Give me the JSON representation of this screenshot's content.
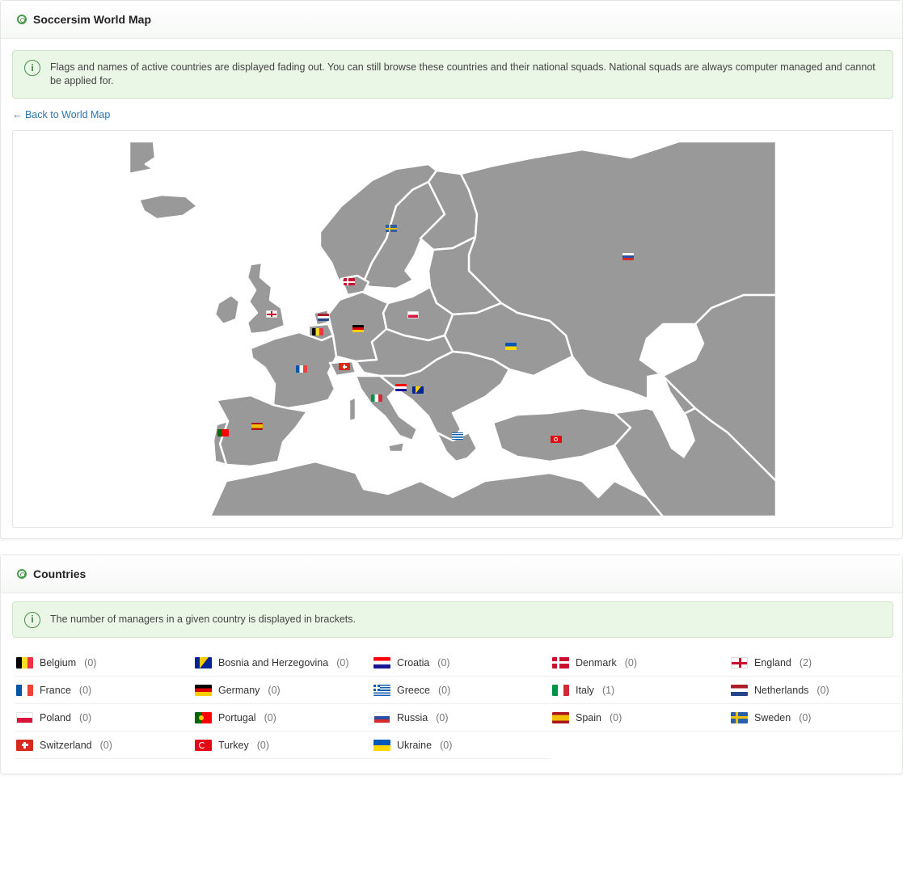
{
  "map_panel": {
    "title": "Soccersim World Map",
    "info_text": "Flags and names of active countries are displayed fading out. You can still browse these countries and their national squads. National squads are always computer managed and cannot be applied for.",
    "back_link": "← Back to World Map"
  },
  "countries_panel": {
    "title": "Countries",
    "info_text": "The number of managers in a given country is displayed in brackets.",
    "countries": [
      {
        "name": "Belgium",
        "count": "(0)",
        "flag": "belgium-flag-icon"
      },
      {
        "name": "Bosnia and Herzegovina",
        "count": "(0)",
        "flag": "bosnia-flag-icon"
      },
      {
        "name": "Croatia",
        "count": "(0)",
        "flag": "croatia-flag-icon"
      },
      {
        "name": "Denmark",
        "count": "(0)",
        "flag": "denmark-flag-icon"
      },
      {
        "name": "England",
        "count": "(2)",
        "flag": "england-flag-icon"
      },
      {
        "name": "France",
        "count": "(0)",
        "flag": "france-flag-icon"
      },
      {
        "name": "Germany",
        "count": "(0)",
        "flag": "germany-flag-icon"
      },
      {
        "name": "Greece",
        "count": "(0)",
        "flag": "greece-flag-icon"
      },
      {
        "name": "Italy",
        "count": "(1)",
        "flag": "italy-flag-icon"
      },
      {
        "name": "Netherlands",
        "count": "(0)",
        "flag": "netherlands-flag-icon"
      },
      {
        "name": "Poland",
        "count": "(0)",
        "flag": "poland-flag-icon"
      },
      {
        "name": "Portugal",
        "count": "(0)",
        "flag": "portugal-flag-icon"
      },
      {
        "name": "Russia",
        "count": "(0)",
        "flag": "russia-flag-icon"
      },
      {
        "name": "Spain",
        "count": "(0)",
        "flag": "spain-flag-icon"
      },
      {
        "name": "Sweden",
        "count": "(0)",
        "flag": "sweden-flag-icon"
      },
      {
        "name": "Switzerland",
        "count": "(0)",
        "flag": "switzerland-flag-icon"
      },
      {
        "name": "Turkey",
        "count": "(0)",
        "flag": "turkey-flag-icon"
      },
      {
        "name": "Ukraine",
        "count": "(0)",
        "flag": "ukraine-flag-icon"
      }
    ]
  },
  "colors": {
    "land": "#999999",
    "border": "#ffffff",
    "info_bg": "#eaf6e6",
    "link": "#2d73ad",
    "accent": "#4a9a4a"
  }
}
